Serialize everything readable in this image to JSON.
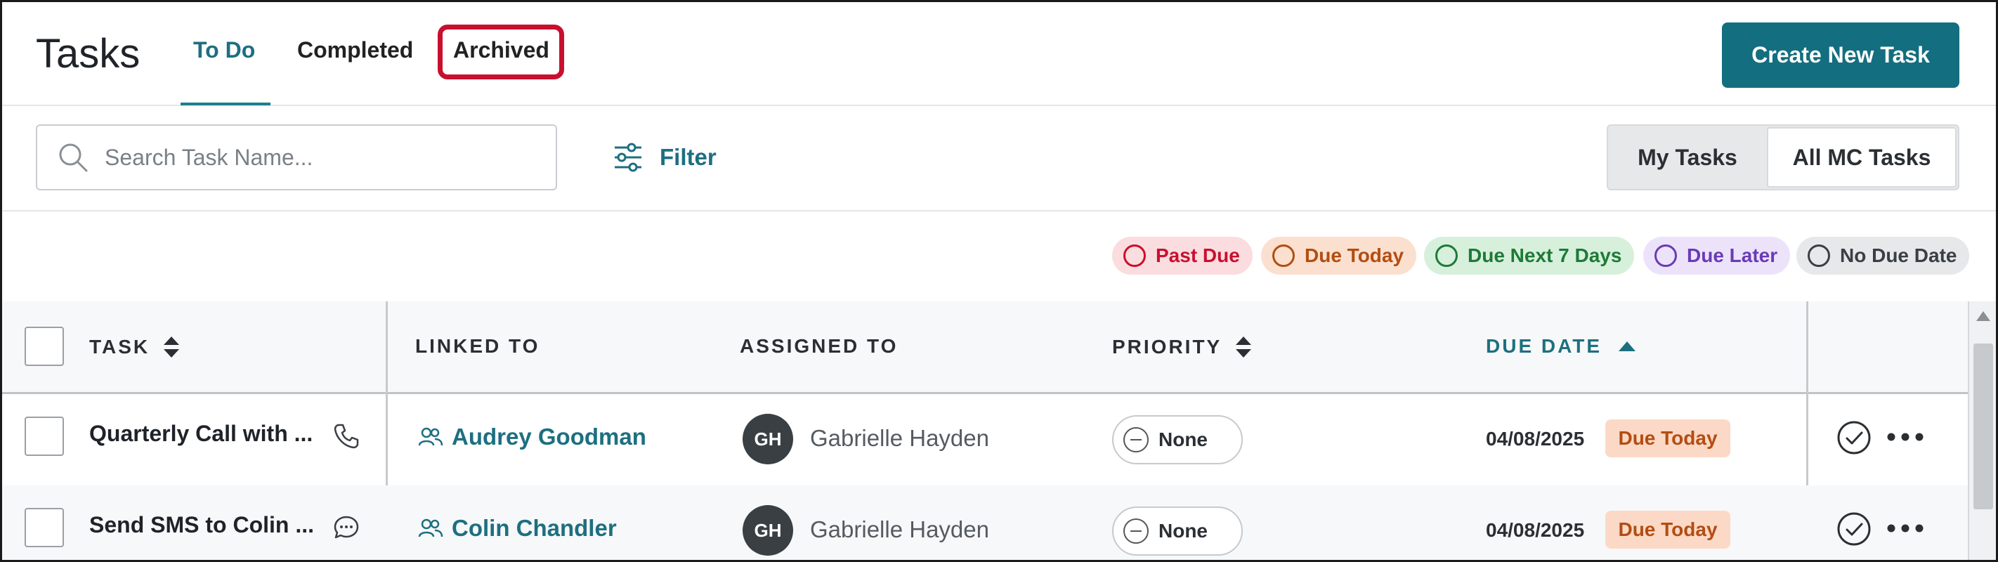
{
  "header": {
    "title": "Tasks",
    "tabs": [
      "To Do",
      "Completed",
      "Archived"
    ],
    "active_tab": "To Do",
    "create_label": "Create New Task"
  },
  "toolbar": {
    "search_placeholder": "Search Task Name...",
    "filter_label": "Filter",
    "segments": [
      "My Tasks",
      "All MC Tasks"
    ],
    "active_segment": "All MC Tasks"
  },
  "legend": [
    {
      "label": "Past Due",
      "color": "#c8102e",
      "bg": "#fbdcdf"
    },
    {
      "label": "Due Today",
      "color": "#b34d12",
      "bg": "#fbe0cf"
    },
    {
      "label": "Due Next 7 Days",
      "color": "#1e7a36",
      "bg": "#d6f0dc"
    },
    {
      "label": "Due Later",
      "color": "#6a3bb5",
      "bg": "#ece3fb"
    },
    {
      "label": "No Due Date",
      "color": "#3a3f44",
      "bg": "#e6e8ea"
    }
  ],
  "table": {
    "columns": {
      "task": "TASK",
      "linked_to": "LINKED TO",
      "assigned_to": "ASSIGNED TO",
      "priority": "PRIORITY",
      "due_date": "DUE DATE"
    },
    "rows": [
      {
        "task": "Quarterly Call with ...",
        "task_icon": "phone-icon",
        "linked_to": "Audrey Goodman",
        "assignee_initials": "GH",
        "assignee": "Gabrielle Hayden",
        "priority": "None",
        "due_date": "04/08/2025",
        "due_status": "Due Today"
      },
      {
        "task": "Send SMS to Colin ...",
        "task_icon": "sms-bubble-icon",
        "linked_to": "Colin Chandler",
        "assignee_initials": "GH",
        "assignee": "Gabrielle Hayden",
        "priority": "None",
        "due_date": "04/08/2025",
        "due_status": "Due Today"
      }
    ]
  },
  "colors": {
    "accent": "#1d6f80",
    "primary_button": "#136e7f",
    "highlight": "#c8102e"
  }
}
